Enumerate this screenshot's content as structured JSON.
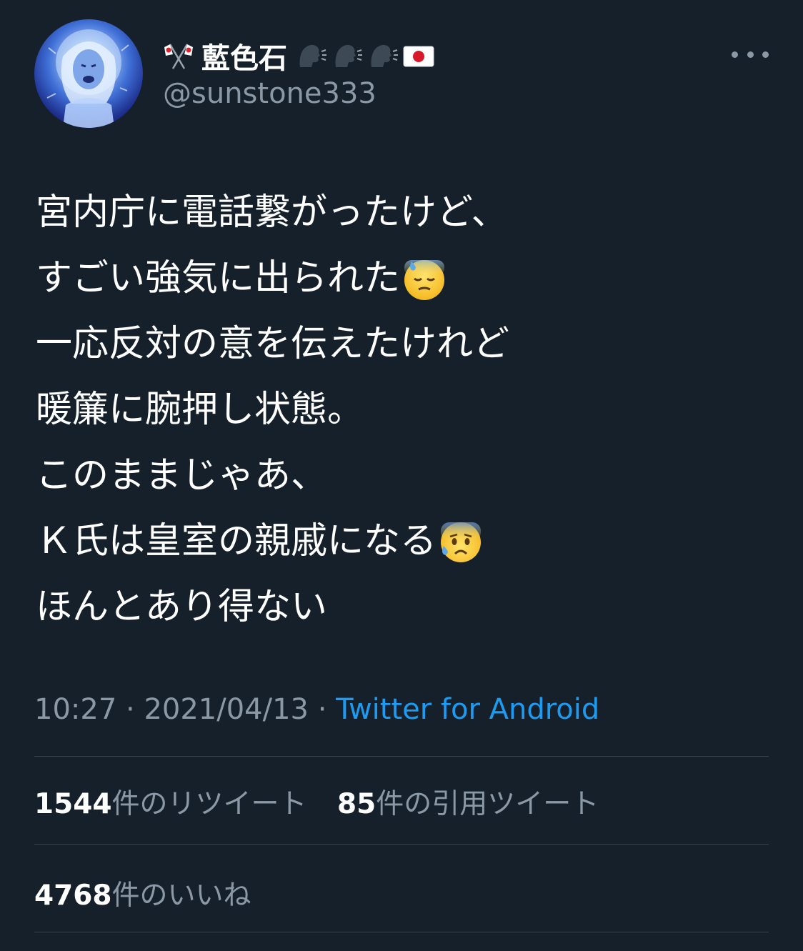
{
  "tweet": {
    "author": {
      "display_name": "藍色石",
      "handle": "@sunstone333",
      "name_prefix_icon": "crossed-japanese-flags",
      "name_suffix_icons": [
        "speaking-head",
        "speaking-head",
        "speaking-head",
        "japan-flag"
      ]
    },
    "lines": [
      "宮内庁に電話繋がったけど、",
      "すごい強気に出られた",
      "一応反対の意を伝えたけれど",
      "暖簾に腕押し状態。",
      "このままじゃあ、",
      "Ｋ氏は皇室の親戚になる",
      "ほんとあり得ない"
    ],
    "line_emojis": {
      "1": "downcast-sweat-face",
      "5": "anxious-sweat-face"
    },
    "time": "10:27",
    "date": "2021/04/13",
    "separator": "·",
    "source": "Twitter for Android"
  },
  "stats": {
    "retweets_count": "1544",
    "retweets_label": "件のリツイート",
    "quotes_count": "85",
    "quotes_label": "件の引用ツイート",
    "likes_count": "4768",
    "likes_label": "件のいいね"
  },
  "colors": {
    "background": "#15202b",
    "text": "#ffffff",
    "secondary": "#8b98a5",
    "link": "#1d9bf0",
    "divider": "#38444d"
  }
}
